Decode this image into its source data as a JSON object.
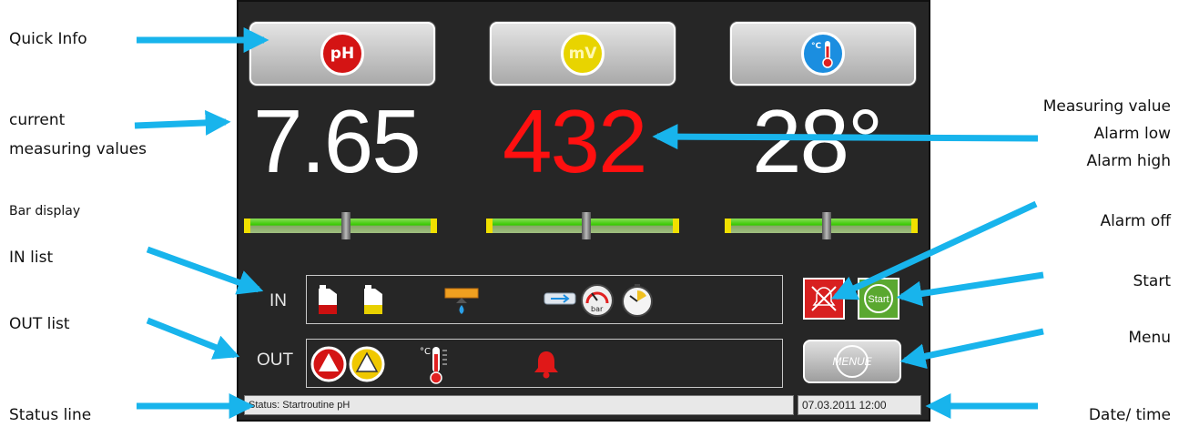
{
  "annotations": {
    "quick_info": "Quick Info",
    "current_values_1": "current",
    "current_values_2": "measuring values",
    "bar_display": "Bar display",
    "in_list": "IN list",
    "out_list": "OUT list",
    "status_line": "Status line",
    "measuring_value": "Measuring value",
    "alarm_low": "Alarm low",
    "alarm_high": "Alarm high",
    "alarm_off": "Alarm off",
    "start": "Start",
    "menu": "Menu",
    "date_time": "Date/ time"
  },
  "quick_buttons": [
    {
      "icon": "ph-icon",
      "text": "pH",
      "color": "#d41414"
    },
    {
      "icon": "mv-icon",
      "text": "mV",
      "color": "#e8d400"
    },
    {
      "icon": "thermometer-icon",
      "text": "°C",
      "color": "#1b8ee0"
    }
  ],
  "values": [
    {
      "text": "7.65",
      "color": "#ffffff"
    },
    {
      "text": "432",
      "color": "#ff1010"
    },
    {
      "text": "28°",
      "color": "#ffffff"
    }
  ],
  "bars": [
    {
      "level": 0.5
    },
    {
      "level": 0.5
    },
    {
      "level": 0.5
    }
  ],
  "in_label": "IN",
  "out_label": "OUT",
  "buttons": {
    "start_label": "Start",
    "menu_label": "MENUE"
  },
  "gauge_unit": "bar",
  "temp_unit": "°C",
  "status": {
    "text": "Status: Startroutine pH",
    "datetime": "07.03.2011  12:00"
  },
  "colors": {
    "arrow": "#18b4ec",
    "panel": "#262626"
  }
}
